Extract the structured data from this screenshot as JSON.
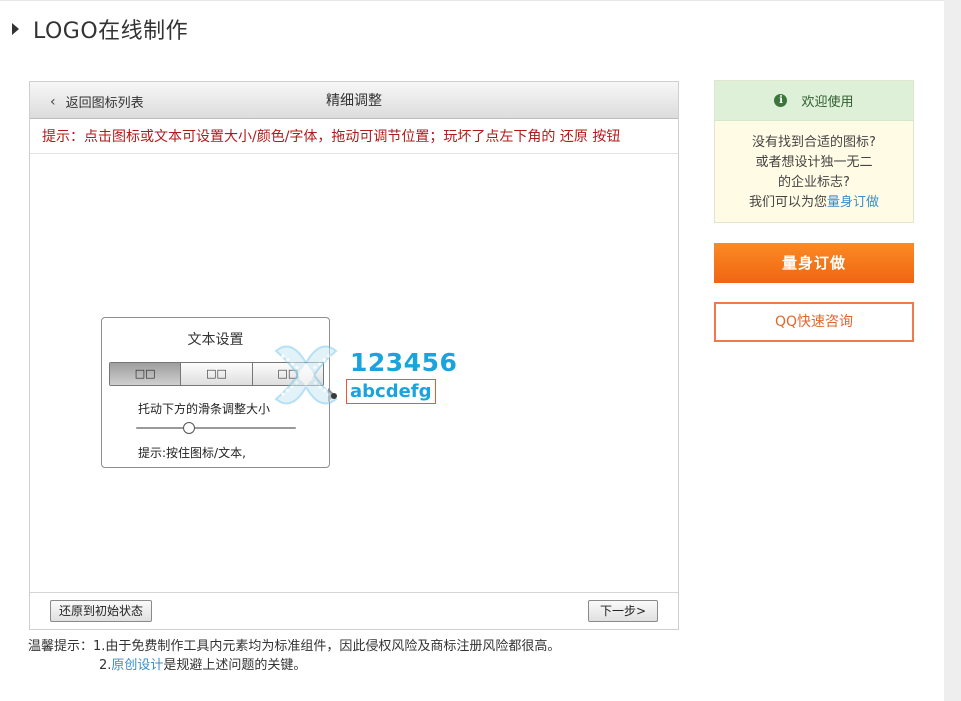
{
  "page": {
    "title": "LOGO在线制作"
  },
  "editor": {
    "back_label": "返回图标列表",
    "title": "精细调整",
    "hint": "提示：点击图标或文本可设置大小/颜色/字体，拖动可调节位置；玩坏了点左下角的 还原 按钮",
    "reset_label": "还原到初始状态",
    "next_label": "下一步>"
  },
  "text_settings": {
    "title": "文本设置",
    "tabs": [
      "□□",
      "□□",
      "□□"
    ],
    "size_label": "托动下方的滑条调整大小",
    "slider_value": 0.33,
    "tip": "提示:按住图标/文本,"
  },
  "logo": {
    "number_text": "123456",
    "text": "abcdefg",
    "color": "#1aa4db",
    "icon": "cross-ribbon-logo-icon"
  },
  "notice": {
    "prefix": "温馨提示：",
    "line1": "1.由于免费制作工具内元素均为标准组件，因此侵权风险及商标注册风险都很高。",
    "line2_pre": "2.",
    "line2_link": "原创设计",
    "line2_post": "是规避上述问题的关键。"
  },
  "sidebar": {
    "welcome": "欢迎使用",
    "body_lines": [
      "没有找到合适的图标?",
      "或者想设计独一无二",
      "的企业标志?"
    ],
    "body_last_pre": "我们可以为您",
    "body_last_link": "量身订做",
    "custom_button": "量身订做",
    "qq_button": "QQ快速咨询"
  },
  "colors": {
    "accent_orange": "#f07a1a",
    "hint_red": "#b01a1a",
    "link_blue": "#3a8fc9",
    "logo_blue": "#1aa4db"
  }
}
